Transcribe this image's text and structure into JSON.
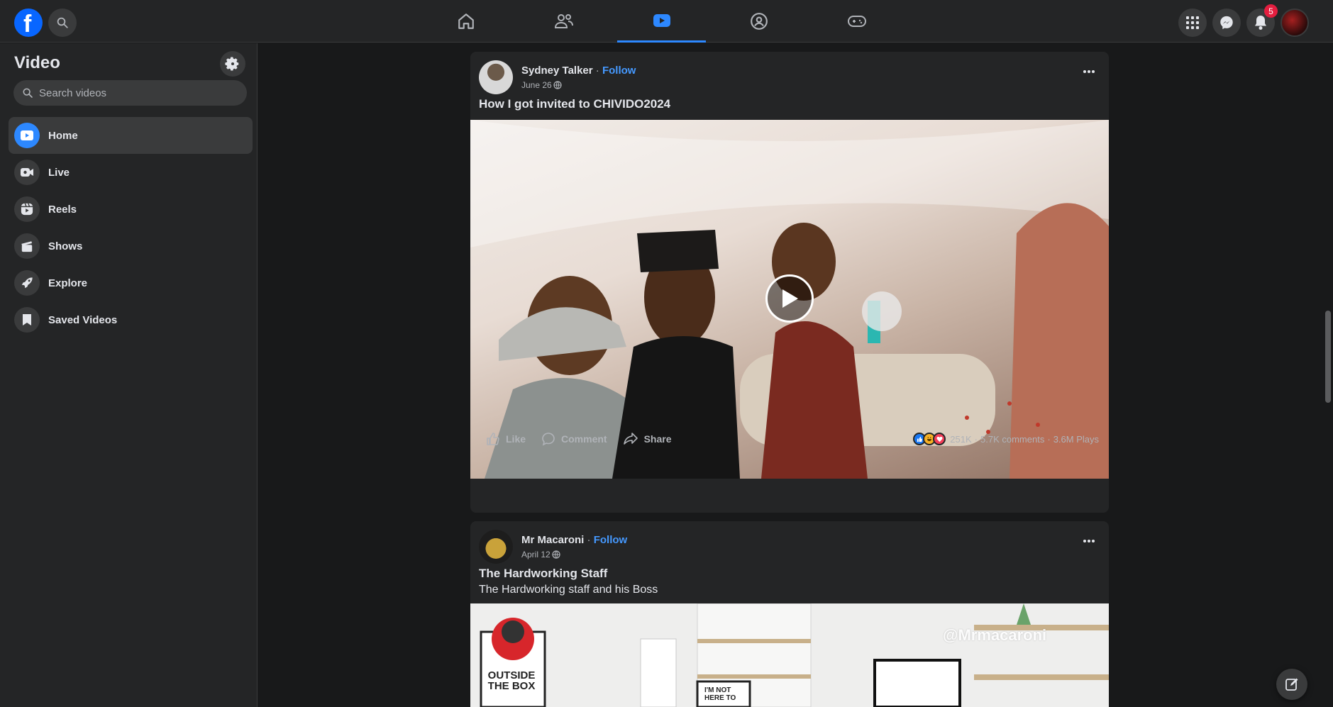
{
  "sidebar": {
    "title": "Video",
    "search_placeholder": "Search videos",
    "items": [
      {
        "label": "Home"
      },
      {
        "label": "Live"
      },
      {
        "label": "Reels"
      },
      {
        "label": "Shows"
      },
      {
        "label": "Explore"
      },
      {
        "label": "Saved Videos"
      }
    ]
  },
  "topbar": {
    "notifications_count": "5",
    "icons": [
      "facebook-logo",
      "search-icon",
      "home-icon",
      "friends-icon",
      "video-icon",
      "groups-icon",
      "gaming-icon",
      "menu-grid-icon",
      "messenger-icon",
      "bell-icon"
    ]
  },
  "posts": [
    {
      "author": "Sydney Talker",
      "separator": "·",
      "follow": "Follow",
      "date": "June 26",
      "title": "How I got invited to CHIVIDO2024",
      "actions": {
        "like": "Like",
        "comment": "Comment",
        "share": "Share"
      },
      "reactions": "251K",
      "comments": "5.7K comments",
      "plays": "3.6M Plays",
      "stat_sep": "·"
    },
    {
      "author": "Mr Macaroni",
      "separator": "·",
      "follow": "Follow",
      "date": "April 12",
      "title": "The Hardworking Staff",
      "description": "The Hardworking staff and his Boss",
      "watermark": "@Mrmacaroni",
      "poster_text": "OUTSIDE THE BOX",
      "frame_text": "I'M NOT HERE TO"
    }
  ],
  "colors": {
    "background": "#18191a",
    "surface": "#242526",
    "accent": "#2d88ff",
    "follow": "#4599ff",
    "badge": "#e41e3f"
  }
}
